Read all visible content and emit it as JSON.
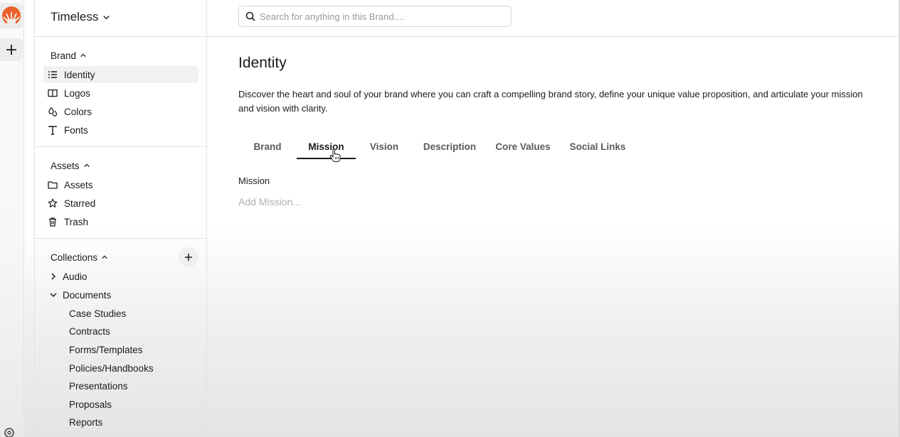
{
  "app": {
    "workspace_name": "Timeless",
    "brand_color": "#e8612c"
  },
  "rail": {
    "logo_icon": "sunburst-logo-icon",
    "add_icon": "plus-icon",
    "settings_icon": "gear-icon"
  },
  "search": {
    "placeholder": "Search for anything in this Brand...."
  },
  "sidebar": {
    "brand_section": {
      "label": "Brand",
      "items": [
        {
          "label": "Identity",
          "icon": "list-icon"
        },
        {
          "label": "Logos",
          "icon": "book-icon"
        },
        {
          "label": "Colors",
          "icon": "drops-icon"
        },
        {
          "label": "Fonts",
          "icon": "type-icon"
        }
      ]
    },
    "assets_section": {
      "label": "Assets",
      "items": [
        {
          "label": "Assets",
          "icon": "folder-icon"
        },
        {
          "label": "Starred",
          "icon": "star-icon"
        },
        {
          "label": "Trash",
          "icon": "trash-icon"
        }
      ]
    },
    "collections_section": {
      "label": "Collections",
      "add_icon": "plus-icon",
      "tree": [
        {
          "label": "Audio",
          "expanded": false
        },
        {
          "label": "Documents",
          "expanded": true
        }
      ],
      "document_children": [
        "Case Studies",
        "Contracts",
        "Forms/Templates",
        "Policies/Handbooks",
        "Presentations",
        "Proposals",
        "Reports"
      ]
    }
  },
  "main": {
    "title": "Identity",
    "description": "Discover the heart and soul of your brand where you can craft a compelling brand story, define your unique value proposition, and articulate your mission and vision with clarity.",
    "tabs": [
      {
        "label": "Brand",
        "active": false
      },
      {
        "label": "Mission",
        "active": true
      },
      {
        "label": "Vision",
        "active": false
      },
      {
        "label": "Description",
        "active": false
      },
      {
        "label": "Core Values",
        "active": false
      },
      {
        "label": "Social Links",
        "active": false
      }
    ],
    "field": {
      "label": "Mission",
      "value": "",
      "placeholder": "Add Mission..."
    }
  }
}
